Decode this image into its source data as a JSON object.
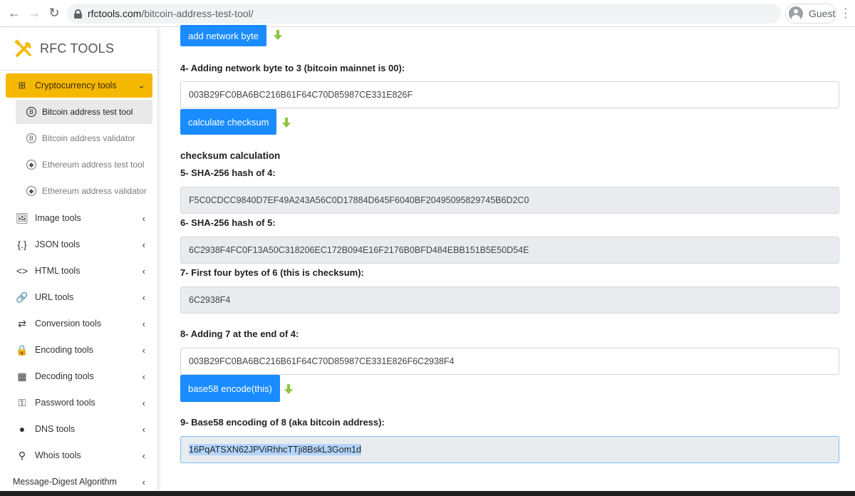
{
  "browser": {
    "url_host": "rfctools.com",
    "url_path": "/bitcoin-address-test-tool/",
    "profile_label": "Guest"
  },
  "sidebar": {
    "brand": "RFC TOOLS",
    "active_section": "Cryptocurrency tools",
    "subitems": [
      {
        "label": "Bitcoin address test tool",
        "icon": "bitcoin-icon"
      },
      {
        "label": "Bitcoin address validator",
        "icon": "bitcoin-icon"
      },
      {
        "label": "Ethereum address test tool",
        "icon": "ethereum-icon"
      },
      {
        "label": "Ethereum address validator",
        "icon": "ethereum-icon"
      }
    ],
    "items": [
      {
        "label": "Image tools",
        "icon": "image-icon"
      },
      {
        "label": "JSON tools",
        "icon": "braces-icon"
      },
      {
        "label": "HTML tools",
        "icon": "code-icon"
      },
      {
        "label": "URL tools",
        "icon": "link-icon"
      },
      {
        "label": "Conversion tools",
        "icon": "convert-icon"
      },
      {
        "label": "Encoding tools",
        "icon": "encode-icon"
      },
      {
        "label": "Decoding tools",
        "icon": "decode-icon"
      },
      {
        "label": "Password tools",
        "icon": "key-icon"
      },
      {
        "label": "DNS tools",
        "icon": "globe-icon"
      },
      {
        "label": "Whois tools",
        "icon": "search-icon"
      },
      {
        "label": "Message-Digest Algorithm",
        "icon": ""
      }
    ]
  },
  "main": {
    "btn_add_network_byte": "add network byte",
    "step4_label": "4- Adding network byte to 3 (bitcoin mainnet is 00):",
    "step4_value": "003B29FC0BA6BC216B61F64C70D85987CE331E826F",
    "btn_calculate_checksum": "calculate checksum",
    "checksum_heading": "checksum calculation",
    "step5_label": "5- SHA-256 hash of 4:",
    "step5_value": "F5C0CDCC9840D7EF49A243A56C0D17884D645F6040BF20495095829745B6D2C0",
    "step6_label": "6- SHA-256 hash of 5:",
    "step6_value": "6C2938F4FC0F13A50C318206EC172B094E16F2176B0BFD484EBB151B5E50D54E",
    "step7_label": "7- First four bytes of 6 (this is checksum):",
    "step7_value": "6C2938F4",
    "step8_label": "8- Adding 7 at the end of 4:",
    "step8_value": "003B29FC0BA6BC216B61F64C70D85987CE331E826F6C2938F4",
    "btn_base58": "base58 encode(this)",
    "step9_label": "9- Base58 encoding of 8 (aka bitcoin address):",
    "step9_value": "16PqATSXN62JPViRhhcTTji8BskL3Gom1d"
  },
  "colors": {
    "accent_yellow": "#f5b800",
    "button_blue": "#1a8cff",
    "arrow_green": "#8cc63f"
  }
}
